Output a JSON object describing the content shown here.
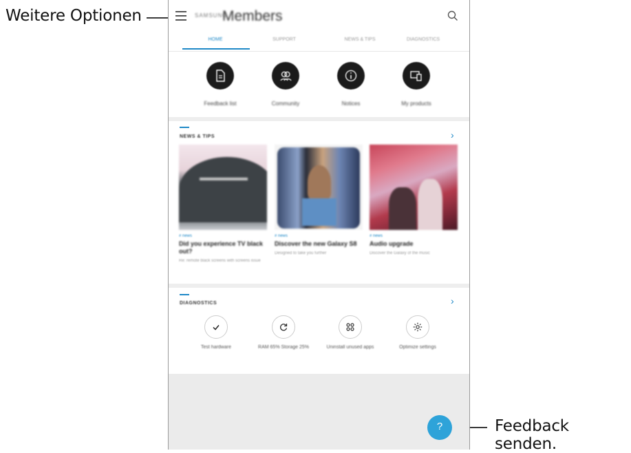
{
  "callouts": {
    "left": "Weitere Optionen",
    "right": "Feedback senden."
  },
  "appbar": {
    "brand": "SAMSUNG",
    "title": "Members"
  },
  "tabs": [
    {
      "label": "HOME",
      "active": true
    },
    {
      "label": "SUPPORT",
      "active": false
    },
    {
      "label": "NEWS & TIPS",
      "active": false
    },
    {
      "label": "DIAGNOSTICS",
      "active": false
    }
  ],
  "quick_actions": [
    {
      "label": "Feedback list",
      "icon": "document-icon"
    },
    {
      "label": "Community",
      "icon": "people-icon"
    },
    {
      "label": "Notices",
      "icon": "info-icon"
    },
    {
      "label": "My products",
      "icon": "devices-icon"
    }
  ],
  "news": {
    "title": "NEWS & TIPS",
    "cards": [
      {
        "tag": "# news",
        "title": "Did you experience TV black out?",
        "sub": "Re: remote black screens with screens issue"
      },
      {
        "tag": "# news",
        "title": "Discover the new Galaxy S8",
        "sub": "Designed to take you further"
      },
      {
        "tag": "# news",
        "title": "Audio upgrade",
        "sub": "Discover the Galaxy of the music"
      }
    ]
  },
  "diagnostics": {
    "title": "DIAGNOSTICS",
    "items": [
      {
        "label": "Test hardware",
        "icon": "check-icon"
      },
      {
        "label": "RAM 65% Storage 25%",
        "icon": "refresh-icon"
      },
      {
        "label": "Uninstall unused apps",
        "icon": "apps-icon"
      },
      {
        "label": "Optimize settings",
        "icon": "gear-icon"
      }
    ]
  },
  "fab": {
    "label": "?"
  },
  "colors": {
    "accent": "#1e88c7",
    "fab": "#2ea3d9",
    "dark_icon": "#1b1b1b"
  }
}
